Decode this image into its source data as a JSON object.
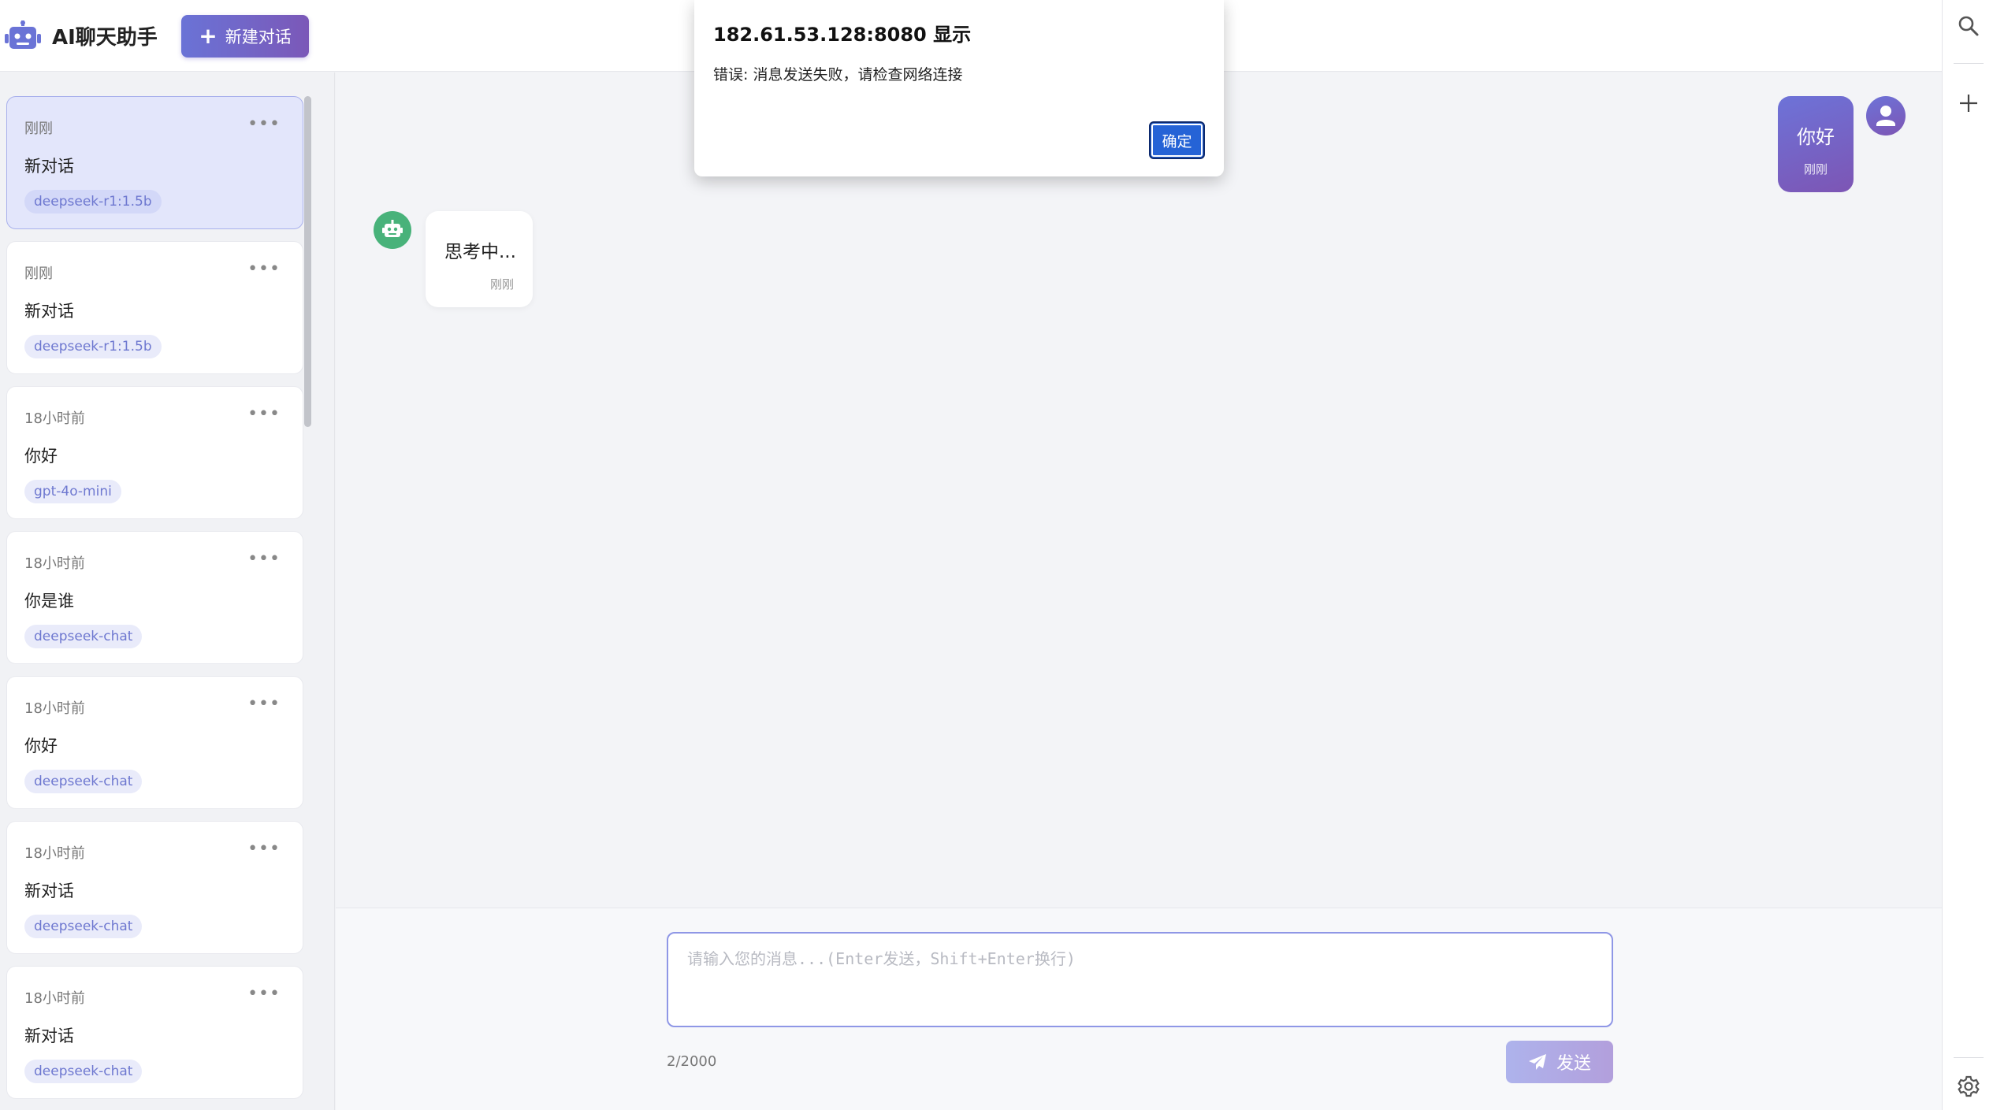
{
  "header": {
    "app_title": "AI聊天助手",
    "new_chat_label": "新建对话"
  },
  "sidebar": {
    "conversations": [
      {
        "time": "刚刚",
        "title": "新对话",
        "model": "deepseek-r1:1.5b",
        "active": true
      },
      {
        "time": "刚刚",
        "title": "新对话",
        "model": "deepseek-r1:1.5b",
        "active": false
      },
      {
        "time": "18小时前",
        "title": "你好",
        "model": "gpt-4o-mini",
        "active": false
      },
      {
        "time": "18小时前",
        "title": "你是谁",
        "model": "deepseek-chat",
        "active": false
      },
      {
        "time": "18小时前",
        "title": "你好",
        "model": "deepseek-chat",
        "active": false
      },
      {
        "time": "18小时前",
        "title": "新对话",
        "model": "deepseek-chat",
        "active": false
      },
      {
        "time": "18小时前",
        "title": "新对话",
        "model": "deepseek-chat",
        "active": false
      }
    ],
    "more_label": "•••"
  },
  "chat": {
    "user_message": {
      "text": "你好",
      "time": "刚刚"
    },
    "bot_message": {
      "text": "思考中...",
      "time": "刚刚"
    }
  },
  "input": {
    "placeholder": "请输入您的消息...(Enter发送，Shift+Enter换行)",
    "value": "",
    "char_count": "2/2000",
    "send_label": "发送"
  },
  "dialog": {
    "title": "182.61.53.128:8080 显示",
    "message": "错误: 消息发送失败，请检查网络连接",
    "ok_label": "确定"
  },
  "right_bar": {
    "icons": [
      "search-icon",
      "plus-icon",
      "gear-icon"
    ]
  },
  "colors": {
    "accent_start": "#6a73d6",
    "accent_end": "#7b58b8",
    "active_card_bg": "#e3e6fb",
    "tag_text": "#6e78d0",
    "bot_avatar": "#48b27a",
    "dialog_ok": "#2563d6"
  }
}
